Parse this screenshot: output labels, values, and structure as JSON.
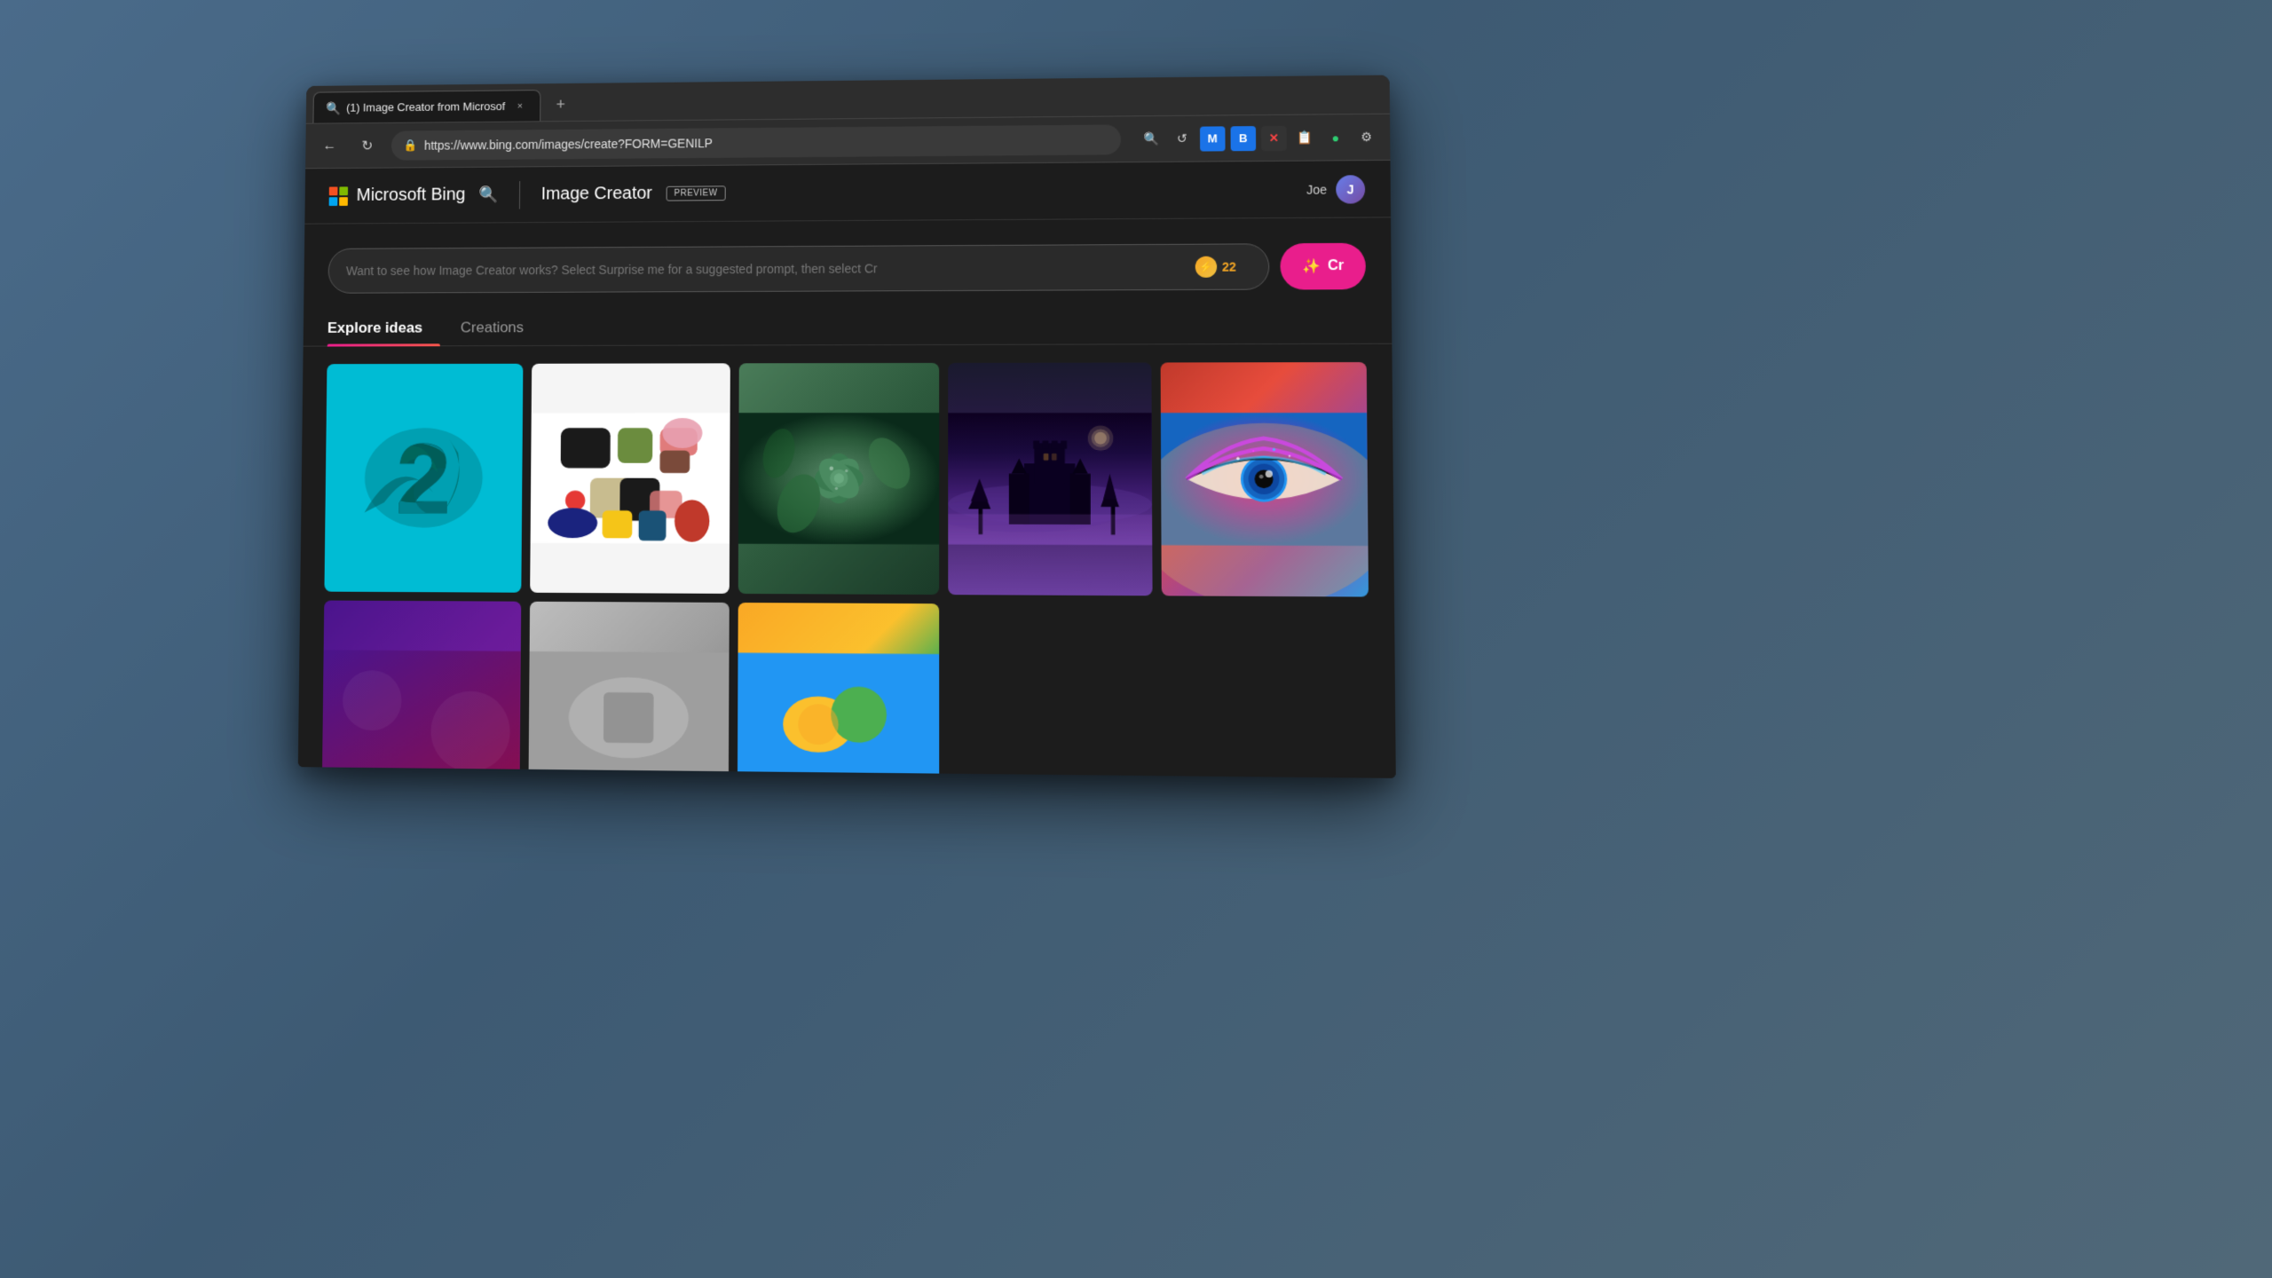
{
  "desktop": {
    "bg_color": "#4a6b8a"
  },
  "browser": {
    "tab": {
      "title": "(1) Image Creator from Microsof",
      "favicon": "🔍",
      "close_label": "×",
      "new_tab_label": "+"
    },
    "address_bar": {
      "url": "https://www.bing.com/images/create?FORM=GENILP",
      "lock_icon": "🔒",
      "back_label": "←",
      "refresh_label": "↻"
    },
    "toolbar": {
      "icons": [
        "🔍",
        "↺",
        "M",
        "B",
        "✕",
        "📋",
        "●",
        "⚙"
      ]
    }
  },
  "page": {
    "nav": {
      "logo_text": "Microsoft Bing",
      "search_icon": "🔍",
      "title": "Image Creator",
      "preview_badge": "PREVIEW",
      "user_name": "Joe"
    },
    "search": {
      "placeholder": "Want to see how Image Creator works? Select Surprise me for a suggested prompt, then select Cr",
      "boost_count": "22",
      "create_label": "Cr"
    },
    "tabs": [
      {
        "label": "Explore ideas",
        "active": true
      },
      {
        "label": "Creations",
        "active": false
      }
    ],
    "images": [
      {
        "id": 1,
        "type": "number-two",
        "alt": "Number 2 on teal background"
      },
      {
        "id": 2,
        "type": "colorful-shapes",
        "alt": "Colorful geometric shapes"
      },
      {
        "id": 3,
        "type": "succulent",
        "alt": "Succulent plant close-up"
      },
      {
        "id": 4,
        "type": "dark-castle",
        "alt": "Dark fantasy castle at night"
      },
      {
        "id": 5,
        "type": "eye-makeup",
        "alt": "Eye with colorful makeup"
      },
      {
        "id": 6,
        "type": "purple-abstract",
        "alt": "Purple abstract art"
      },
      {
        "id": 7,
        "type": "gray-abstract",
        "alt": "Gray abstract composition"
      },
      {
        "id": 8,
        "type": "colorful-fruit",
        "alt": "Colorful fruit"
      }
    ]
  }
}
